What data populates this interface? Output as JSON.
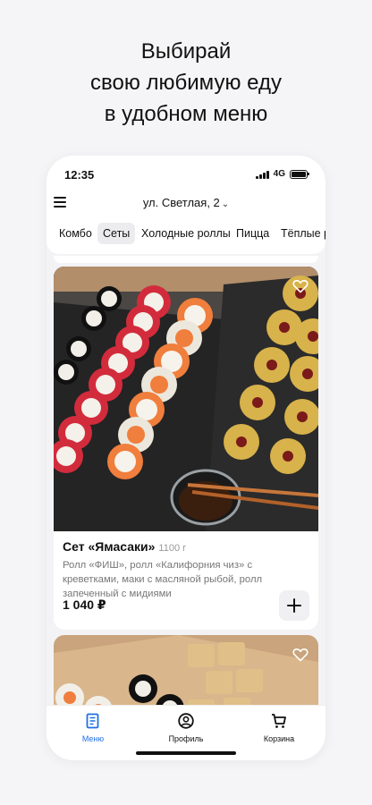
{
  "promo": {
    "line1": "Выбирай",
    "line2": "свою любимую еду",
    "line3": "в удобном меню"
  },
  "status_bar": {
    "time": "12:35",
    "network": "4G"
  },
  "header": {
    "address": "ул. Светлая, 2"
  },
  "tabs": [
    {
      "label": "Комбо",
      "active": false
    },
    {
      "label": "Сеты",
      "active": true
    },
    {
      "label": "Холодные роллы",
      "active": false
    },
    {
      "label": "Пицца",
      "active": false
    },
    {
      "label": "Тёплые р",
      "active": false
    }
  ],
  "product": {
    "title": "Сет «Ямасаки»",
    "weight": "1100 г",
    "description": "Ролл «ФИШ», ролл «Калифорния чиз» с креветками, маки с масляной рыбой, ролл запеченный с мидиями",
    "price": "1 040 ₽"
  },
  "bottom_nav": [
    {
      "label": "Меню",
      "icon": "menu-doc-icon",
      "active": true
    },
    {
      "label": "Профиль",
      "icon": "profile-icon",
      "active": false
    },
    {
      "label": "Корзина",
      "icon": "cart-icon",
      "active": false
    }
  ],
  "colors": {
    "accent": "#1f6fe5",
    "background": "#f5f5f7"
  }
}
